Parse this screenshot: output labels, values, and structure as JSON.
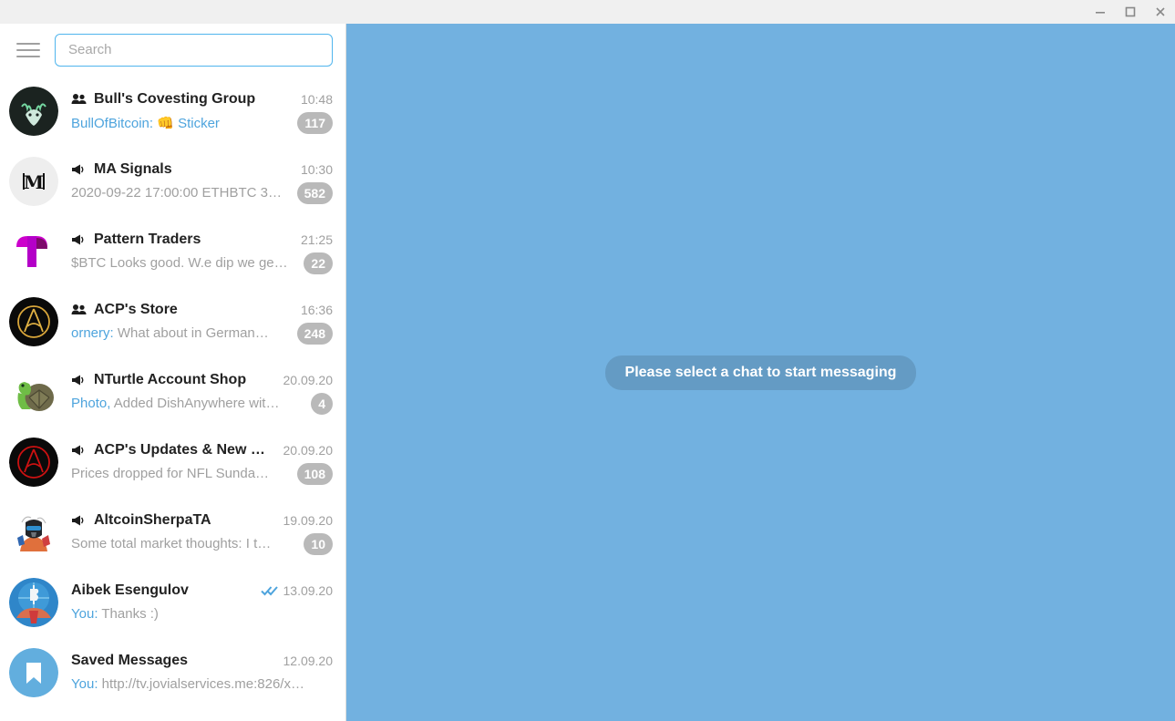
{
  "window": {
    "controls": [
      {
        "name": "minimize-button",
        "label": "Minimize",
        "glyph": "minimize"
      },
      {
        "name": "maximize-button",
        "label": "Maximize",
        "glyph": "maximize"
      },
      {
        "name": "close-button",
        "label": "Close",
        "glyph": "close"
      }
    ]
  },
  "sidebar": {
    "menu_button_label": "Menu",
    "search": {
      "placeholder": "Search",
      "value": ""
    },
    "chats": [
      {
        "name": "Bull's Covesting Group",
        "type_icon": "group-icon",
        "time": "10:48",
        "preview_sender": "BullOfBitcoin:",
        "preview_emoji": "👊",
        "preview_text": "Sticker",
        "preview_text_color": "link",
        "badge": "117",
        "read_status": "",
        "avatar": "bull-avatar"
      },
      {
        "name": "MA Signals",
        "type_icon": "channel-icon",
        "time": "10:30",
        "preview_sender": "",
        "preview_emoji": "",
        "preview_text": "2020-09-22 17:00:00 ETHBTC 3…",
        "preview_text_color": "muted",
        "badge": "582",
        "read_status": "",
        "avatar": "ma-signals-avatar"
      },
      {
        "name": "Pattern Traders",
        "type_icon": "channel-icon",
        "time": "21:25",
        "preview_sender": "",
        "preview_emoji": "",
        "preview_text": "$BTC Looks good. W.e dip we ge…",
        "preview_text_color": "muted",
        "badge": "22",
        "read_status": "",
        "avatar": "pattern-traders-avatar"
      },
      {
        "name": "ACP's Store",
        "type_icon": "group-icon",
        "time": "16:36",
        "preview_sender": "ornery:",
        "preview_emoji": "",
        "preview_text": "What about in German…",
        "preview_text_color": "muted",
        "badge": "248",
        "read_status": "",
        "avatar": "acp-store-avatar"
      },
      {
        "name": "NTurtle Account Shop",
        "type_icon": "channel-icon",
        "time": "20.09.20",
        "preview_sender": "",
        "preview_media": "Photo,",
        "preview_emoji": "",
        "preview_text": "Added DishAnywhere wit…",
        "preview_text_color": "muted",
        "badge": "4",
        "read_status": "",
        "avatar": "nturtle-avatar"
      },
      {
        "name": "ACP's Updates & New S…",
        "type_icon": "channel-icon",
        "time": "20.09.20",
        "preview_sender": "",
        "preview_emoji": "",
        "preview_text": "Prices dropped for NFL Sunda…",
        "preview_text_color": "muted",
        "badge": "108",
        "read_status": "",
        "avatar": "acp-updates-avatar"
      },
      {
        "name": "AltcoinSherpaTA",
        "type_icon": "channel-icon",
        "time": "19.09.20",
        "preview_sender": "",
        "preview_emoji": "",
        "preview_text": "Some total market thoughts: I t…",
        "preview_text_color": "muted",
        "badge": "10",
        "read_status": "",
        "avatar": "altcoinsherpa-avatar"
      },
      {
        "name": "Aibek Esengulov",
        "type_icon": "",
        "time": "13.09.20",
        "preview_sender": "You:",
        "preview_emoji": "",
        "preview_text": "Thanks :)",
        "preview_text_color": "muted",
        "badge": "",
        "read_status": "read-double-check-icon",
        "avatar": "aibek-avatar"
      },
      {
        "name": "Saved Messages",
        "type_icon": "",
        "time": "12.09.20",
        "preview_sender": "You:",
        "preview_emoji": "",
        "preview_text": "http://tv.jovialservices.me:826/x…",
        "preview_text_color": "muted",
        "badge": "",
        "read_status": "",
        "avatar": "saved-messages-avatar"
      }
    ]
  },
  "chat_pane": {
    "empty_state_text": "Please select a chat to start messaging"
  },
  "colors": {
    "accent": "#4ea4dd",
    "pane_background": "#72b1e0",
    "badge_muted": "#b9b9b9",
    "search_border": "#50b5ed",
    "titlebar": "#f0f0f0"
  }
}
